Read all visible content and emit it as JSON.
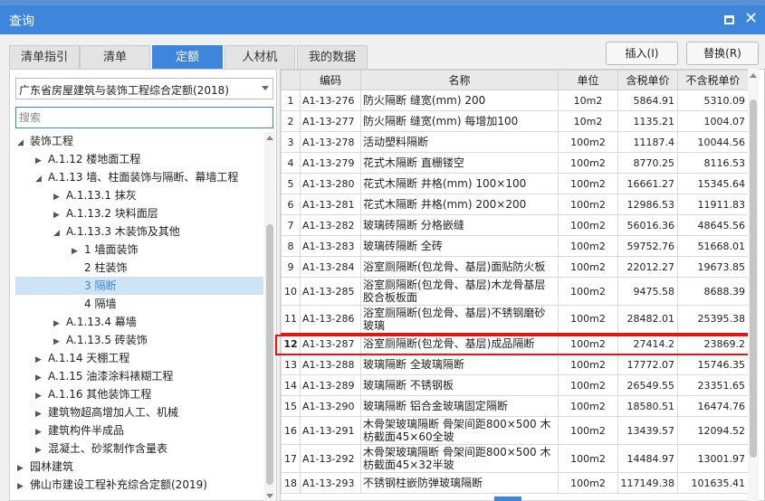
{
  "window": {
    "title": "查询"
  },
  "tabs": [
    {
      "label": "清单指引",
      "active": false
    },
    {
      "label": "清单",
      "active": false
    },
    {
      "label": "定额",
      "active": true
    },
    {
      "label": "人材机",
      "active": false
    },
    {
      "label": "我的数据",
      "active": false
    }
  ],
  "buttons": {
    "insert": "插入(I)",
    "replace": "替换(R)"
  },
  "left": {
    "library": "广东省房屋建筑与装饰工程综合定额(2018)",
    "search_placeholder": "搜索",
    "tree": [
      {
        "label": "装饰工程",
        "expanded": true
      },
      {
        "label": "A.1.12 楼地面工程",
        "expanded": false
      },
      {
        "label": "A.1.13 墙、柱面装饰与隔断、幕墙工程",
        "expanded": true
      },
      {
        "label": "A.1.13.1 抹灰",
        "expanded": false
      },
      {
        "label": "A.1.13.2 块料面层",
        "expanded": false
      },
      {
        "label": "A.1.13.3 木装饰及其他",
        "expanded": true
      },
      {
        "label": "1 墙面装饰",
        "expanded": false
      },
      {
        "label": "2 柱装饰",
        "expanded": null
      },
      {
        "label": "3 隔断",
        "expanded": null,
        "selected": true
      },
      {
        "label": "4 隔墙",
        "expanded": null
      },
      {
        "label": "A.1.13.4 幕墙",
        "expanded": false
      },
      {
        "label": "A.1.13.5 砖装饰",
        "expanded": false
      },
      {
        "label": "A.1.14 天棚工程",
        "expanded": false
      },
      {
        "label": "A.1.15 油漆涂料裱糊工程",
        "expanded": false
      },
      {
        "label": "A.1.16 其他装饰工程",
        "expanded": false
      },
      {
        "label": "建筑物超高增加人工、机械",
        "expanded": false
      },
      {
        "label": "建筑构件半成品",
        "expanded": false
      },
      {
        "label": "混凝土、砂浆制作含量表",
        "expanded": false
      },
      {
        "label": "园林建筑",
        "expanded": false
      },
      {
        "label": "佛山市建设工程补充综合定额(2019)",
        "expanded": false
      }
    ]
  },
  "table": {
    "headers": [
      "",
      "编码",
      "名称",
      "单位",
      "含税单价",
      "不含税单价"
    ],
    "rows": [
      {
        "no": "1",
        "code": "A1-13-276",
        "name": "防火隔断 缝宽(mm) 200",
        "unit": "10m2",
        "tax": "5864.91",
        "notax": "5310.09"
      },
      {
        "no": "2",
        "code": "A1-13-277",
        "name": "防火隔断 缝宽(mm) 每增加100",
        "unit": "10m2",
        "tax": "1135.21",
        "notax": "1004.07"
      },
      {
        "no": "3",
        "code": "A1-13-278",
        "name": "活动塑料隔断",
        "unit": "100m2",
        "tax": "11187.4",
        "notax": "10044.56"
      },
      {
        "no": "4",
        "code": "A1-13-279",
        "name": "花式木隔断 直栅镂空",
        "unit": "100m2",
        "tax": "8770.25",
        "notax": "8116.53"
      },
      {
        "no": "5",
        "code": "A1-13-280",
        "name": "花式木隔断 井格(mm) 100×100",
        "unit": "100m2",
        "tax": "16661.27",
        "notax": "15345.64"
      },
      {
        "no": "6",
        "code": "A1-13-281",
        "name": "花式木隔断 井格(mm) 200×200",
        "unit": "100m2",
        "tax": "12986.53",
        "notax": "11911.83"
      },
      {
        "no": "7",
        "code": "A1-13-282",
        "name": "玻璃砖隔断 分格嵌缝",
        "unit": "100m2",
        "tax": "56016.36",
        "notax": "48645.56"
      },
      {
        "no": "8",
        "code": "A1-13-283",
        "name": "玻璃砖隔断 全砖",
        "unit": "100m2",
        "tax": "59752.76",
        "notax": "51668.01"
      },
      {
        "no": "9",
        "code": "A1-13-284",
        "name": "浴室厕隔断(包龙骨、基层)面贴防火板",
        "unit": "100m2",
        "tax": "22012.27",
        "notax": "19673.85"
      },
      {
        "no": "10",
        "code": "A1-13-285",
        "name": "浴室厕隔断(包龙骨、基层)木龙骨基层胶合板板面",
        "unit": "100m2",
        "tax": "9475.58",
        "notax": "8688.39"
      },
      {
        "no": "11",
        "code": "A1-13-286",
        "name": "浴室厕隔断(包龙骨、基层)不锈钢磨砂玻璃",
        "unit": "100m2",
        "tax": "28482.01",
        "notax": "25395.38"
      },
      {
        "no": "12",
        "code": "A1-13-287",
        "name": "浴室厕隔断(包龙骨、基层)成品隔断",
        "unit": "100m2",
        "tax": "27414.2",
        "notax": "23869.2",
        "highlight": true
      },
      {
        "no": "13",
        "code": "A1-13-288",
        "name": "玻璃隔断 全玻璃隔断",
        "unit": "100m2",
        "tax": "17772.07",
        "notax": "15746.35"
      },
      {
        "no": "14",
        "code": "A1-13-289",
        "name": "玻璃隔断 不锈钢板",
        "unit": "100m2",
        "tax": "26549.55",
        "notax": "23351.65"
      },
      {
        "no": "15",
        "code": "A1-13-290",
        "name": "玻璃隔断 铝合金玻璃固定隔断",
        "unit": "100m2",
        "tax": "18580.51",
        "notax": "16474.76"
      },
      {
        "no": "16",
        "code": "A1-13-291",
        "name": "木骨架玻璃隔断 骨架间距800×500 木枋截面45×60全玻",
        "unit": "100m2",
        "tax": "13439.57",
        "notax": "12094.52"
      },
      {
        "no": "17",
        "code": "A1-13-292",
        "name": "木骨架玻璃隔断 骨架间距800×500 木枋截面45×32半玻",
        "unit": "100m2",
        "tax": "14484.97",
        "notax": "13001.97"
      },
      {
        "no": "18",
        "code": "A1-13-293",
        "name": "不锈钢柱嵌防弹玻璃隔断",
        "unit": "100m2",
        "tax": "117149.38",
        "notax": "101635.41"
      }
    ]
  }
}
